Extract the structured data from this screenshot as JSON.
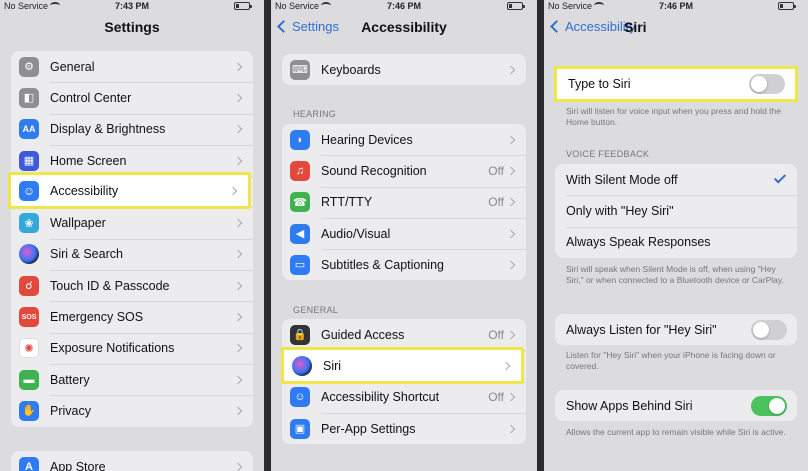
{
  "status": {
    "carrier": "No Service",
    "p1_time": "7:43 PM",
    "p2_time": "7:46 PM",
    "p3_time": "7:46 PM"
  },
  "panel1": {
    "title": "Settings",
    "items": [
      {
        "label": "General",
        "icon": "gear-icon",
        "color": "#8e8e93",
        "glyph": "⚙"
      },
      {
        "label": "Control Center",
        "icon": "toggles-icon",
        "color": "#8e8e93",
        "glyph": "◧"
      },
      {
        "label": "Display & Brightness",
        "icon": "text-size-icon",
        "color": "#2f7bf2",
        "glyph": "AA"
      },
      {
        "label": "Home Screen",
        "icon": "grid-icon",
        "color": "#3b5bdb",
        "glyph": "▦"
      },
      {
        "label": "Accessibility",
        "icon": "accessibility-icon",
        "color": "#2f7bf2",
        "glyph": "☺"
      },
      {
        "label": "Wallpaper",
        "icon": "flower-icon",
        "color": "#34a8d8",
        "glyph": "❀"
      },
      {
        "label": "Siri & Search",
        "icon": "siri-icon",
        "color": "#222",
        "glyph": "◉"
      },
      {
        "label": "Touch ID & Passcode",
        "icon": "fingerprint-icon",
        "color": "#e3483c",
        "glyph": "☌"
      },
      {
        "label": "Emergency SOS",
        "icon": "sos-icon",
        "color": "#e3483c",
        "glyph": "SOS"
      },
      {
        "label": "Exposure Notifications",
        "icon": "exposure-icon",
        "color": "#fff",
        "glyph": "✺"
      },
      {
        "label": "Battery",
        "icon": "battery-icon",
        "color": "#3fb34f",
        "glyph": "▬"
      },
      {
        "label": "Privacy",
        "icon": "hand-icon",
        "color": "#2f7bf2",
        "glyph": "✋"
      }
    ],
    "app_store": {
      "label": "App Store",
      "icon": "app-store-icon",
      "color": "#2f7bf2",
      "glyph": "A"
    }
  },
  "panel2": {
    "back": "Settings",
    "title": "Accessibility",
    "keyboards": {
      "label": "Keyboards",
      "icon": "keyboard-icon",
      "color": "#8e8e93",
      "glyph": "⌨"
    },
    "hearing_head": "HEARING",
    "hearing": [
      {
        "label": "Hearing Devices",
        "icon": "ear-icon",
        "color": "#2f7bf2",
        "glyph": "◗",
        "value": ""
      },
      {
        "label": "Sound Recognition",
        "icon": "sound-recognition-icon",
        "color": "#e3483c",
        "glyph": "♫",
        "value": "Off"
      },
      {
        "label": "RTT/TTY",
        "icon": "tty-icon",
        "color": "#3fb34f",
        "glyph": "☎",
        "value": "Off"
      },
      {
        "label": "Audio/Visual",
        "icon": "speaker-icon",
        "color": "#2f7bf2",
        "glyph": "◀",
        "value": ""
      },
      {
        "label": "Subtitles & Captioning",
        "icon": "captions-icon",
        "color": "#2f7bf2",
        "glyph": "▭",
        "value": ""
      }
    ],
    "general_head": "GENERAL",
    "general": [
      {
        "label": "Guided Access",
        "icon": "lock-icon",
        "color": "#333",
        "glyph": "🔒",
        "value": "Off"
      },
      {
        "label": "Siri",
        "icon": "siri-icon",
        "color": "#222",
        "glyph": "◉",
        "value": ""
      },
      {
        "label": "Accessibility Shortcut",
        "icon": "accessibility-icon",
        "color": "#2f7bf2",
        "glyph": "☺",
        "value": "Off"
      },
      {
        "label": "Per-App Settings",
        "icon": "per-app-icon",
        "color": "#2f7bf2",
        "glyph": "▣",
        "value": ""
      }
    ]
  },
  "panel3": {
    "back": "Accessibility",
    "title": "Siri",
    "type_to_siri": "Type to Siri",
    "type_note": "Siri will listen for voice input when you press and hold the Home button.",
    "voice_head": "VOICE FEEDBACK",
    "voice_options": [
      "With Silent Mode off",
      "Only with \"Hey Siri\"",
      "Always Speak Responses"
    ],
    "voice_note": "Siri will speak when Silent Mode is off, when using \"Hey Siri,\" or when connected to a Bluetooth device or CarPlay.",
    "always_listen": "Always Listen for \"Hey Siri\"",
    "listen_note": "Listen for \"Hey Siri\" when your iPhone is facing down or covered.",
    "show_apps": "Show Apps Behind Siri",
    "apps_note": "Allows the current app to remain visible while Siri is active."
  }
}
